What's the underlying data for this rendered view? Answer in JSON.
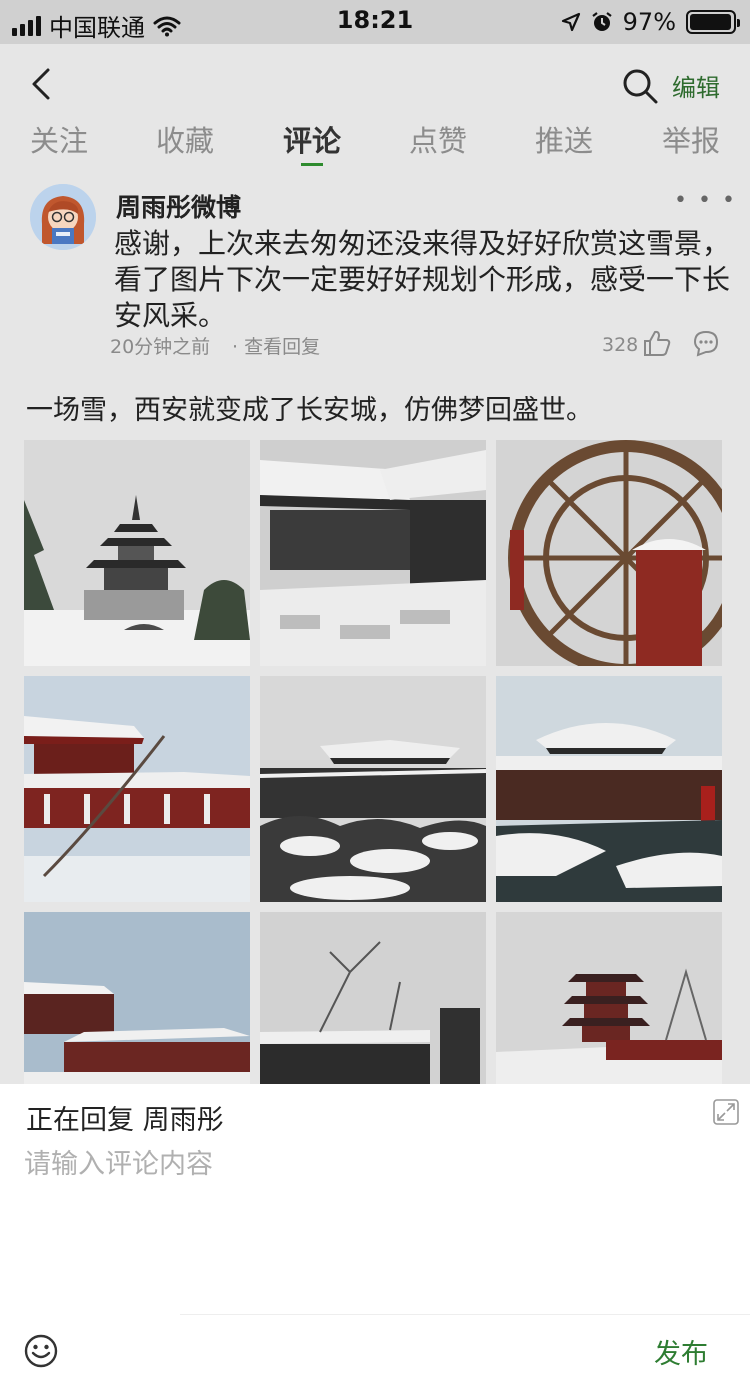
{
  "status_bar": {
    "carrier": "中国联通",
    "time": "18:21",
    "battery_percent": "97%",
    "battery_level": 0.97,
    "icons": [
      "signal-icon",
      "wifi-icon",
      "location-arrow-icon",
      "alarm-icon",
      "battery-icon"
    ]
  },
  "nav": {
    "edit_label": "编辑",
    "icons": [
      "back-icon",
      "search-icon"
    ]
  },
  "tabs": [
    {
      "label": "关注"
    },
    {
      "label": "收藏"
    },
    {
      "label": "评论",
      "active": true
    },
    {
      "label": "点赞"
    },
    {
      "label": "推送"
    },
    {
      "label": "举报"
    }
  ],
  "comment": {
    "author": "周雨彤微博",
    "text": "感谢，上次来去匆匆还没来得及好好欣赏这雪景，看了图片下次一定要好好规划个形成，感受一下长安风采。",
    "time": "20分钟之前",
    "reply_link": "· 查看回复",
    "likes": "328",
    "icons": [
      "more-icon",
      "thumbs-up-icon",
      "reply-bubble-icon"
    ]
  },
  "post": {
    "text": "一场雪，西安就变成了长安城，仿佛梦回盛世。"
  },
  "photos": [
    {
      "name": "photo-pagoda-pavilion"
    },
    {
      "name": "photo-snowy-courtyard"
    },
    {
      "name": "photo-waterwheel"
    },
    {
      "name": "photo-red-pavilion-lake"
    },
    {
      "name": "photo-snowy-palace-rocks"
    },
    {
      "name": "photo-pavilion-river"
    },
    {
      "name": "photo-palace-hall-sky"
    },
    {
      "name": "photo-snowy-trees-wall"
    },
    {
      "name": "photo-tall-pagoda"
    }
  ],
  "compose": {
    "replying_to": "正在回复  周雨彤",
    "placeholder": "请输入评论内容",
    "send_label": "发布",
    "icons": [
      "expand-icon",
      "emoji-icon"
    ]
  },
  "colors": {
    "accent_green": "#2e7d32",
    "dim_overlay": "#e6e6e6",
    "status_bar_bg": "#d0d0d0"
  }
}
